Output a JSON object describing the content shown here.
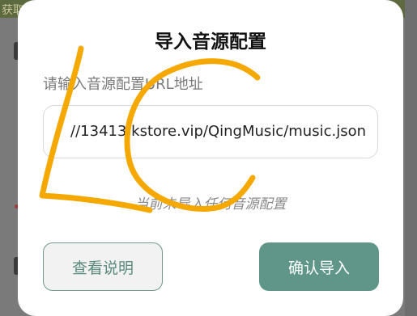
{
  "dialog": {
    "title": "导入音源配置",
    "field_label": "请输入音源配置URL地址",
    "url_value": "//13413.kstore.vip/QingMusic/music.json",
    "status_text": "当前未导入任何音源配置",
    "help_button": "查看说明",
    "confirm_button": "确认导入"
  },
  "background": {
    "topbar_text": "获取"
  },
  "colors": {
    "accent": "#5f9689",
    "annotation": "#f5a800"
  }
}
